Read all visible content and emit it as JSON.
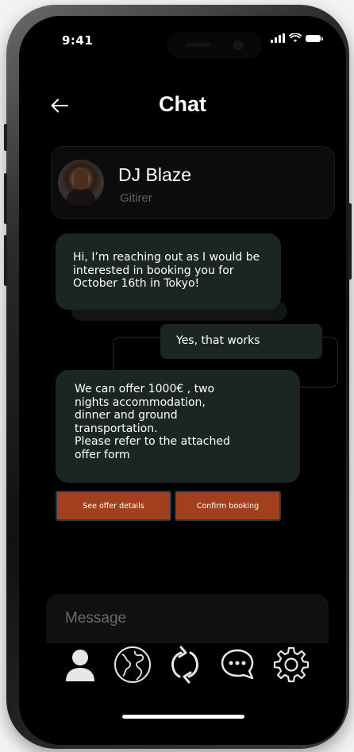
{
  "status_bar": {
    "time": "9:41"
  },
  "header": {
    "title": "Chat"
  },
  "profile": {
    "name": "DJ Blaze",
    "subtitle": "Gitirer"
  },
  "messages": [
    {
      "from": "them",
      "text": "Hi, I’m reaching out as I would be interested in booking you for October 16th in Tokyo!"
    },
    {
      "from": "me",
      "text": "Yes, that works"
    },
    {
      "from": "them",
      "lines": [
        "We can offer 1000€ , two",
        "nights accommodation,",
        "dinner and ground",
        "transportation.",
        "Please refer to the attached",
        "offer form"
      ]
    }
  ],
  "actions": {
    "offer_details": "See offer details",
    "confirm_booking": "Confirm booking"
  },
  "composer": {
    "placeholder": "Message"
  },
  "nav": [
    "profile-icon",
    "globe-icon",
    "refresh-icon",
    "chat-icon",
    "settings-icon"
  ],
  "colors": {
    "accent": "#a2401d",
    "bubble": "#1b2624",
    "background": "#000000"
  }
}
